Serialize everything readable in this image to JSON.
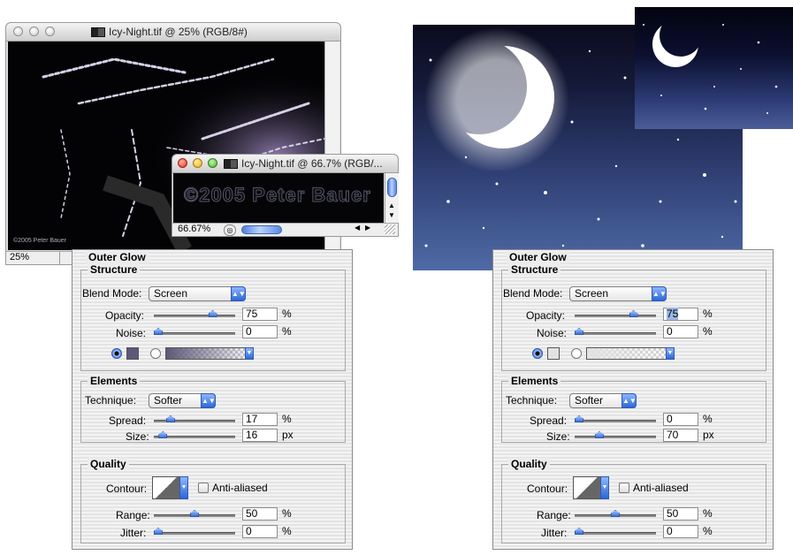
{
  "left_window": {
    "title": "Icy-Night.tif @ 25% (RGB/8#)",
    "watermark": "©2005 Peter Bauer",
    "zoom": "25%"
  },
  "float_window": {
    "title": "Icy-Night.tif @ 66.7% (RGB/...",
    "watermark": "©2005 Peter Bauer",
    "zoom": "66.67%"
  },
  "panels": [
    {
      "title": "Outer Glow",
      "structure": {
        "title": "Structure",
        "blend_mode_label": "Blend Mode:",
        "blend_mode": "Screen",
        "opacity_label": "Opacity:",
        "opacity": "75",
        "opacity_level": 0.75,
        "opacity_unit": "%",
        "noise_label": "Noise:",
        "noise": "0",
        "noise_level": 0,
        "noise_unit": "%",
        "glow_color": "#5e5878"
      },
      "elements": {
        "title": "Elements",
        "technique_label": "Technique:",
        "technique": "Softer",
        "spread_label": "Spread:",
        "spread": "17",
        "spread_level": 0.17,
        "spread_unit": "%",
        "size_label": "Size:",
        "size": "16",
        "size_level": 0.064,
        "size_unit": "px"
      },
      "quality": {
        "title": "Quality",
        "contour_label": "Contour:",
        "anti_aliased_label": "Anti-aliased",
        "range_label": "Range:",
        "range": "50",
        "range_level": 0.5,
        "range_unit": "%",
        "jitter_label": "Jitter:",
        "jitter": "0",
        "jitter_level": 0,
        "jitter_unit": "%"
      }
    },
    {
      "title": "Outer Glow",
      "structure": {
        "title": "Structure",
        "blend_mode_label": "Blend Mode:",
        "blend_mode": "Screen",
        "opacity_label": "Opacity:",
        "opacity": "75",
        "opacity_level": 0.75,
        "opacity_unit": "%",
        "noise_label": "Noise:",
        "noise": "0",
        "noise_level": 0,
        "noise_unit": "%",
        "glow_color": "#e2e2e2"
      },
      "elements": {
        "title": "Elements",
        "technique_label": "Technique:",
        "technique": "Softer",
        "spread_label": "Spread:",
        "spread": "0",
        "spread_level": 0,
        "spread_unit": "%",
        "size_label": "Size:",
        "size": "70",
        "size_level": 0.28,
        "size_unit": "px"
      },
      "quality": {
        "title": "Quality",
        "contour_label": "Contour:",
        "anti_aliased_label": "Anti-aliased",
        "range_label": "Range:",
        "range": "50",
        "range_level": 0.5,
        "range_unit": "%",
        "jitter_label": "Jitter:",
        "jitter": "0",
        "jitter_level": 0,
        "jitter_unit": "%"
      }
    }
  ]
}
